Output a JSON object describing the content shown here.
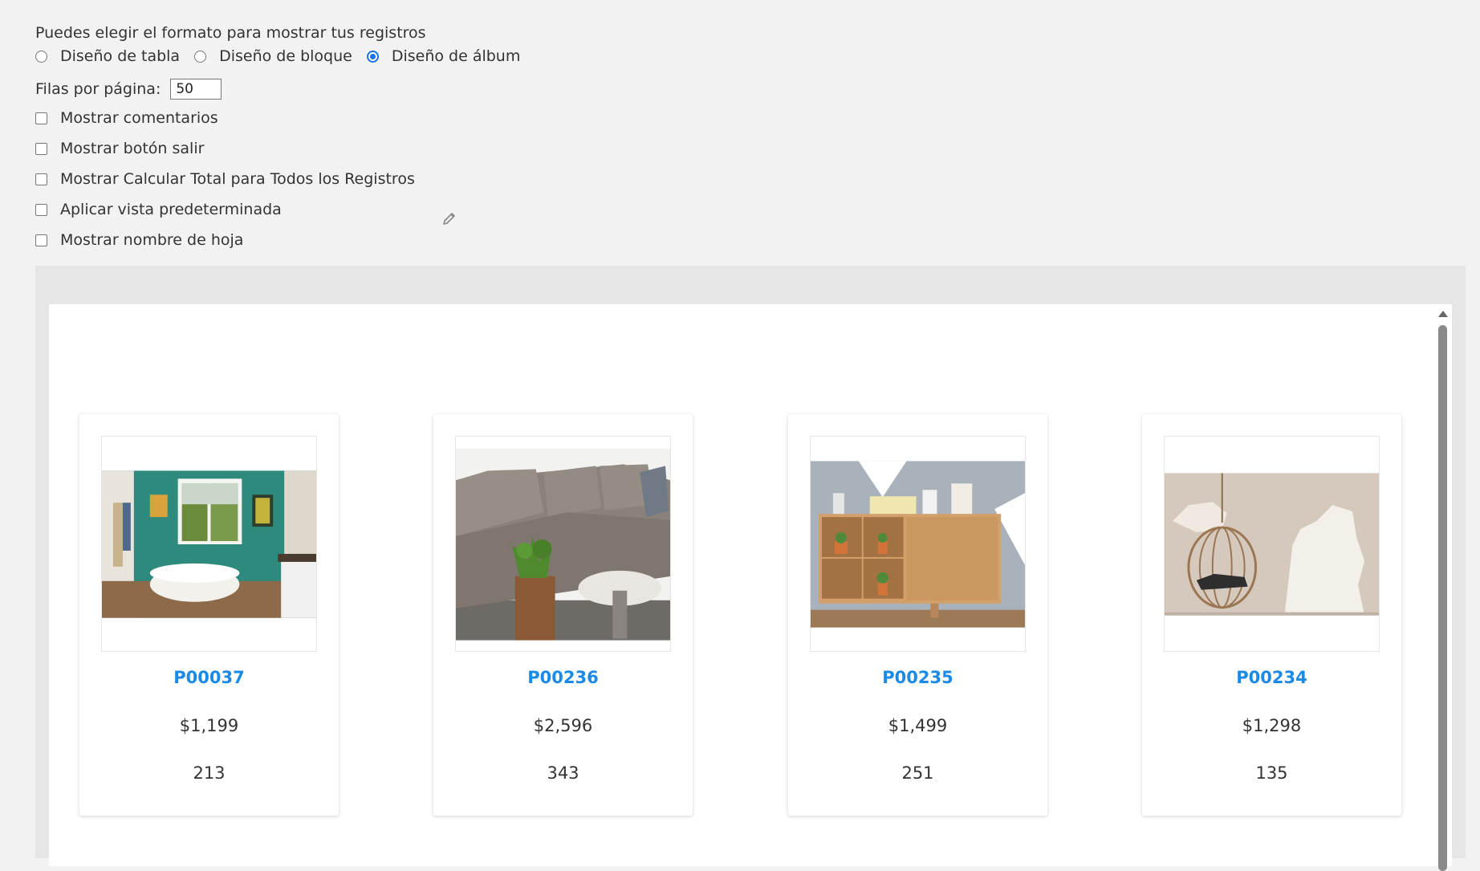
{
  "settings": {
    "intro": "Puedes elegir el formato para mostrar tus registros",
    "layouts": [
      {
        "label": "Diseño de tabla",
        "checked": false
      },
      {
        "label": "Diseño de bloque",
        "checked": false
      },
      {
        "label": "Diseño de álbum",
        "checked": true
      }
    ],
    "rows_label": "Filas por página:",
    "rows_value": "50",
    "checkboxes": [
      {
        "label": "Mostrar comentarios",
        "checked": false
      },
      {
        "label": "Mostrar botón salir",
        "checked": false
      },
      {
        "label": "Mostrar Calcular Total para Todos los Registros",
        "checked": false
      },
      {
        "label": "Aplicar vista predeterminada",
        "checked": false
      },
      {
        "label": "Mostrar nombre de hoja",
        "checked": false
      }
    ],
    "edit_icon": "pencil-icon"
  },
  "album": {
    "cards": [
      {
        "code": "P00037",
        "price": "$1,199",
        "qty": "213",
        "image": "bathroom-photo"
      },
      {
        "code": "P00236",
        "price": "$2,596",
        "qty": "343",
        "image": "sofa-photo"
      },
      {
        "code": "P00235",
        "price": "$1,499",
        "qty": "251",
        "image": "sideboard-photo"
      },
      {
        "code": "P00234",
        "price": "$1,298",
        "qty": "135",
        "image": "hanging-chair-photo"
      }
    ]
  },
  "colors": {
    "accent": "#1a8ae6",
    "radio": "#1a73e8",
    "background": "#f2f2f2"
  }
}
